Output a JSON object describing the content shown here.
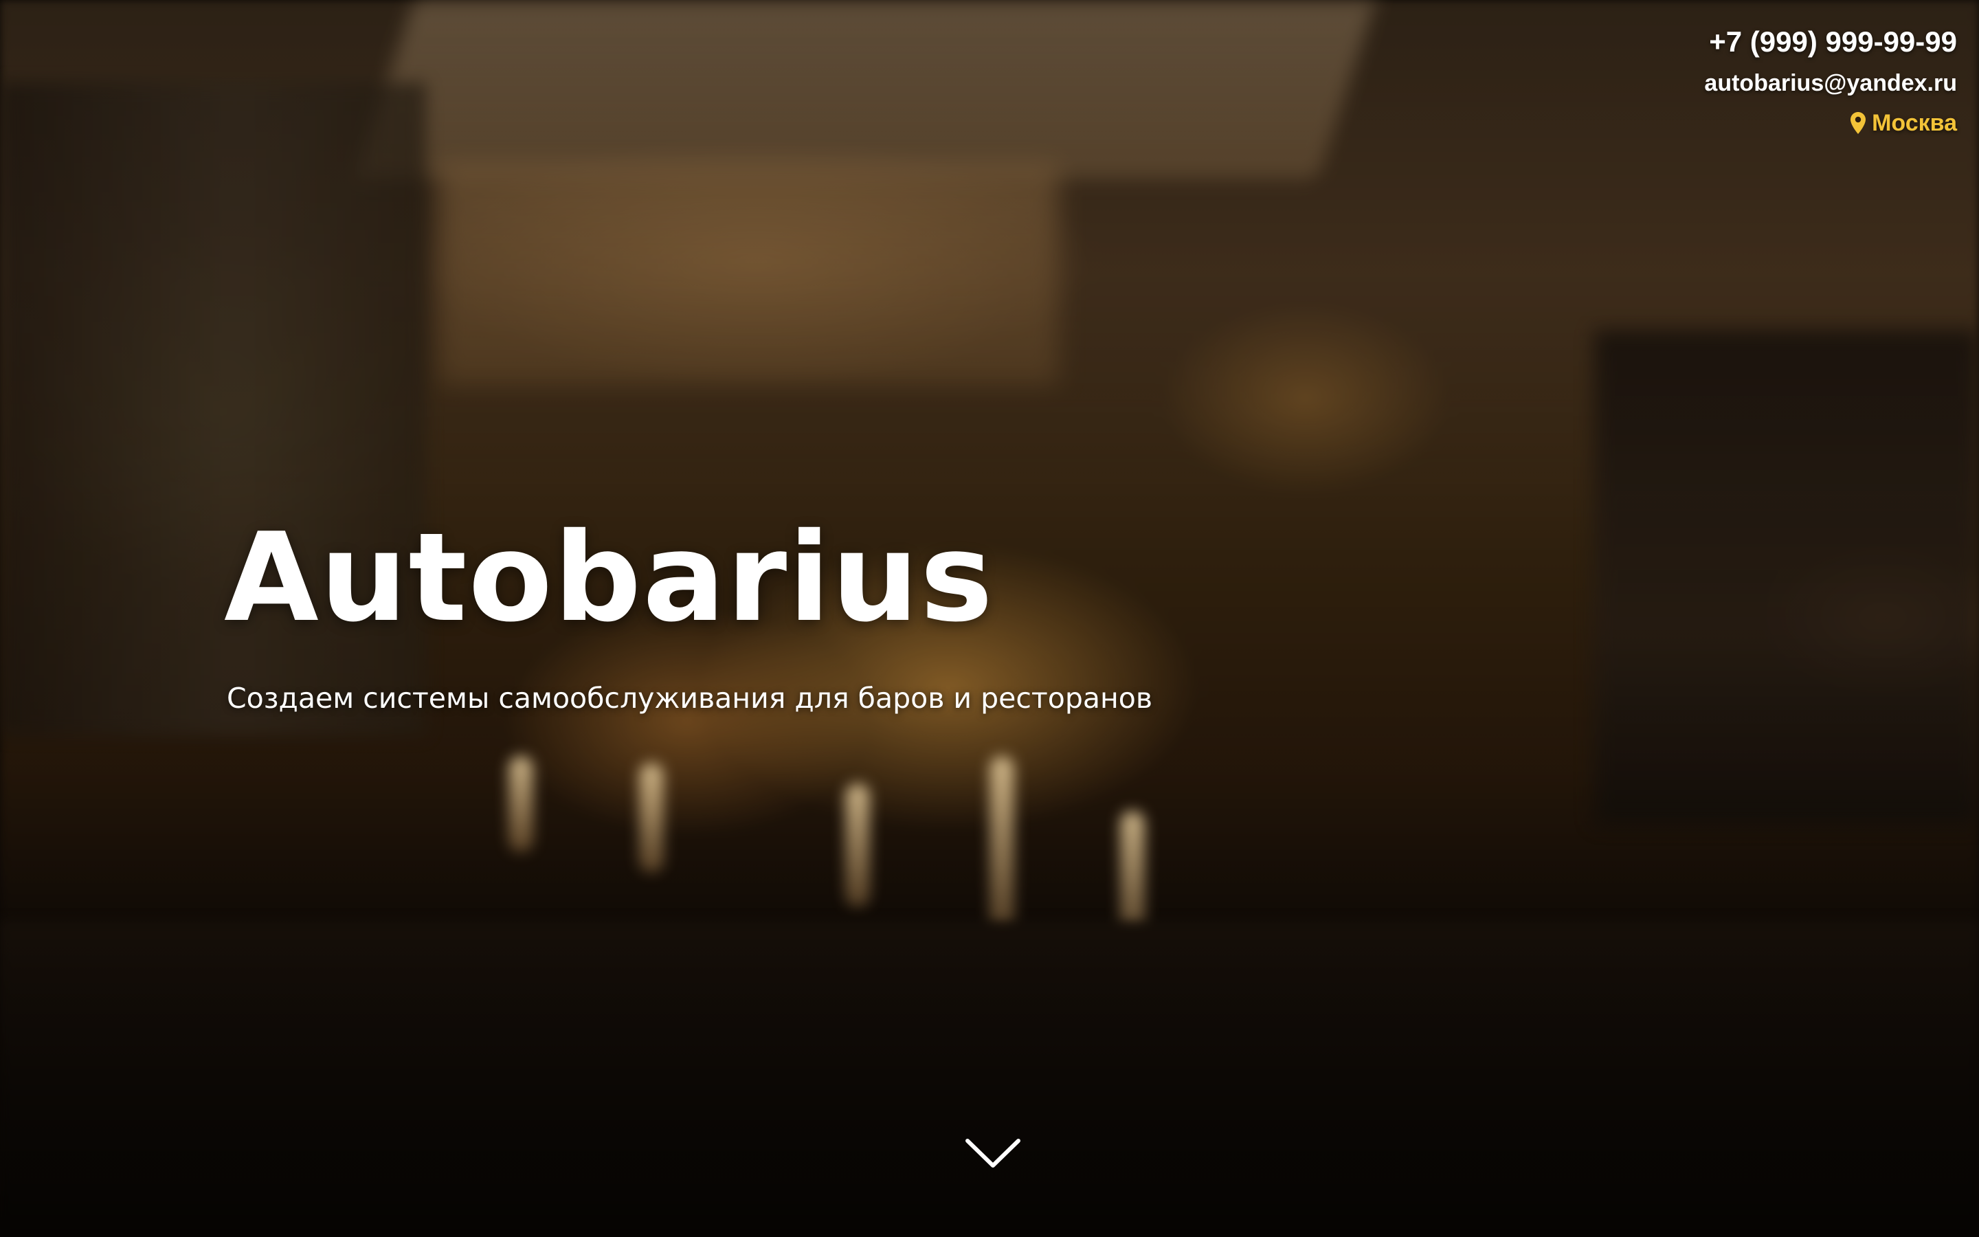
{
  "header": {
    "phone": "+7 (999) 999-99-99",
    "email": "autobarius@yandex.ru",
    "city": "Москва",
    "city_icon": "map-pin-icon",
    "city_color": "#f3c338"
  },
  "hero": {
    "title": "Autobarius",
    "tagline": "Создаем системы самообслуживания для баров и ресторанов",
    "scroll_icon": "chevron-down-icon"
  },
  "colors": {
    "text": "#ffffff",
    "accent": "#f3c338"
  }
}
